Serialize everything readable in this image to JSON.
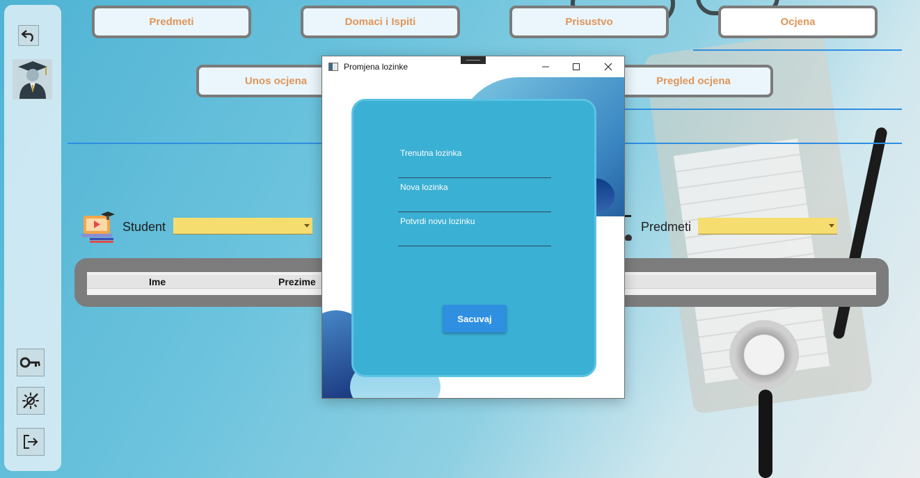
{
  "nav": {
    "predmeti": "Predmeti",
    "domaci_ispiti": "Domaci i Ispiti",
    "prisustvo": "Prisustvo",
    "ocjena": "Ocjena",
    "unos_ocjena": "Unos ocjena",
    "pregled_ocjena": "Pregled ocjena"
  },
  "filters": {
    "student_label": "Student",
    "student_value": "",
    "predmeti_label": "Predmeti",
    "predmeti_value": ""
  },
  "table": {
    "columns": [
      "Ime",
      "Prezime"
    ]
  },
  "dialog": {
    "title": "Promjena lozinke",
    "fields": [
      {
        "label": "Trenutna lozinka",
        "value": ""
      },
      {
        "label": "Nova lozinka",
        "value": ""
      },
      {
        "label": "Potvrdi novu lozinku",
        "value": ""
      }
    ],
    "save_label": "Sacuvaj"
  },
  "colors": {
    "nav_text": "#e0955a",
    "card_bg": "#3ab0d4",
    "save_button": "#2f8fe0",
    "combo_bg": "#f6dd70",
    "accent_line": "#2d8ee0"
  },
  "icons": {
    "back": "undo-arrow-icon",
    "avatar": "graduate-avatar-icon",
    "key": "key-icon",
    "theme": "no-brightness-icon",
    "logout": "logout-icon",
    "student": "student-laptop-icon"
  }
}
